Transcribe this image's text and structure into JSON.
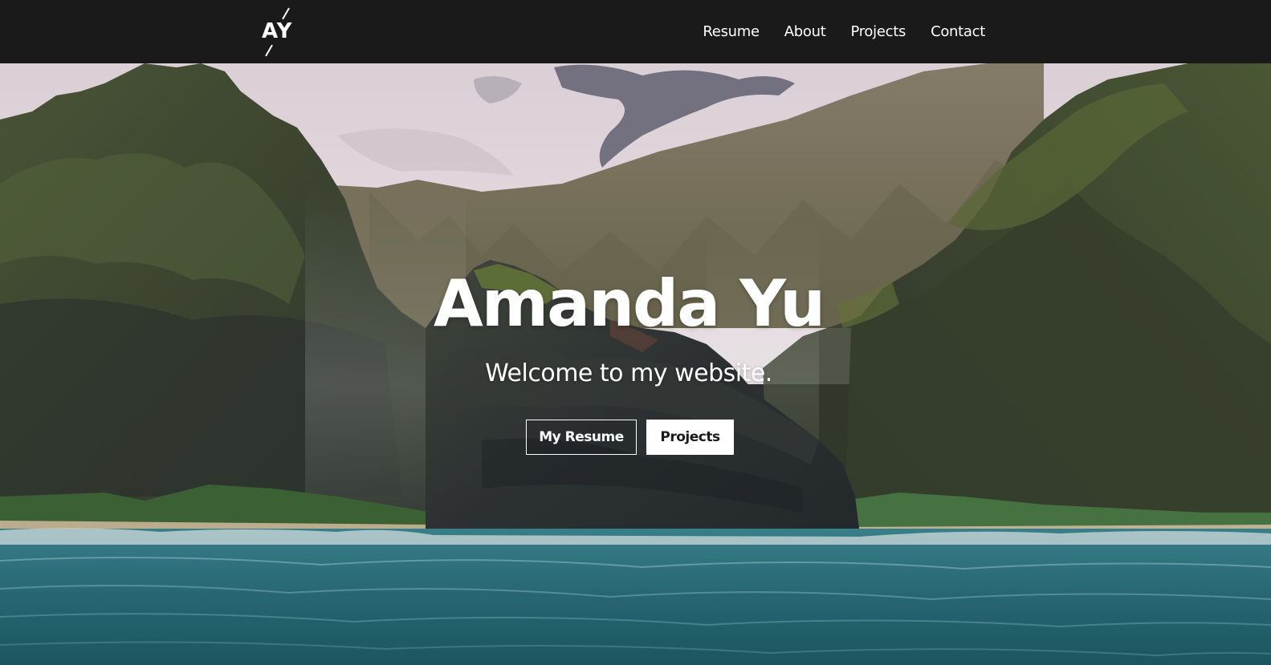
{
  "logo": {
    "text": "AY"
  },
  "nav": {
    "items": [
      {
        "label": "Resume"
      },
      {
        "label": "About"
      },
      {
        "label": "Projects"
      },
      {
        "label": "Contact"
      }
    ]
  },
  "hero": {
    "title": "Amanda Yu",
    "subtitle": "Welcome to my website.",
    "buttons": {
      "resume": "My Resume",
      "projects": "Projects"
    }
  },
  "colors": {
    "navbar_bg": "#1b1a1b",
    "text_light": "#ffffff",
    "sky": "#f2e6ec",
    "ocean": "#2a6f7a",
    "rock": "#33383a",
    "cliff_green": "#5a6a3a"
  }
}
